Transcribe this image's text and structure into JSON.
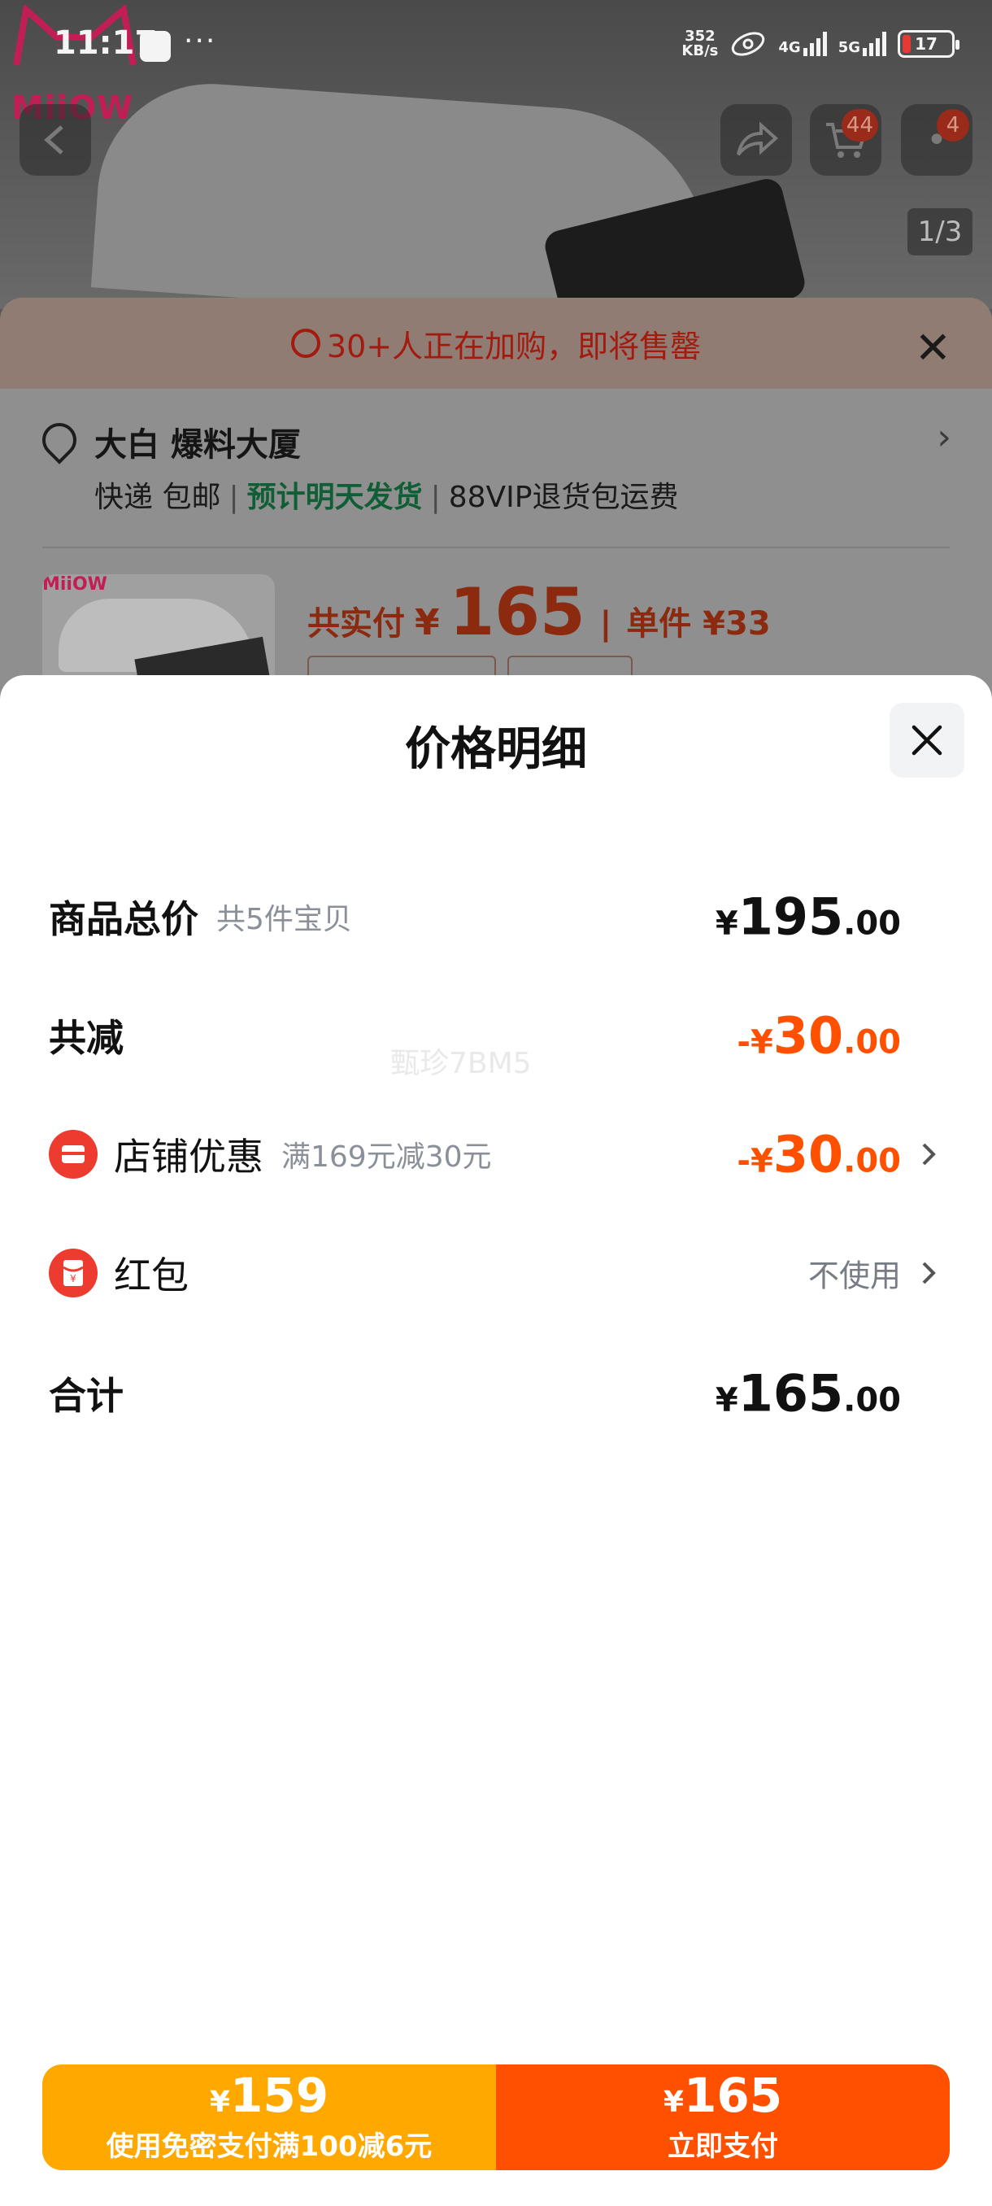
{
  "status_bar": {
    "time": "11:17",
    "dots": "···",
    "net_speed_value": "352",
    "net_speed_unit": "KB/s",
    "sig1": "4G",
    "sig2": "5G",
    "battery": "17"
  },
  "background": {
    "logo_text": "MiiOW",
    "cart_badge": "44",
    "more_badge": "4",
    "pager": "1/3",
    "urgency_text": "30+人正在加购，即将售罄",
    "address_name": "大白 爆料大厦",
    "ship_1": "快递 包邮",
    "ship_2": "预计明天发货",
    "ship_3": "88VIP退货包运费",
    "pay_label": "共实付",
    "pay_currency": "¥",
    "pay_amount": "165",
    "unit_label": "单件 ¥33"
  },
  "sheet": {
    "title": "价格明细",
    "watermark": "甄珍7BM5",
    "rows": {
      "total": {
        "label": "商品总价",
        "sub": "共5件宝贝",
        "currency": "¥",
        "int": "195",
        "dec": ".00"
      },
      "reduce": {
        "label": "共减",
        "currency": "-¥",
        "int": "30",
        "dec": ".00"
      },
      "store": {
        "label": "店铺优惠",
        "sub": "满169元减30元",
        "currency": "-¥",
        "int": "30",
        "dec": ".00"
      },
      "hongbao": {
        "label": "红包",
        "action": "不使用"
      },
      "sum": {
        "label": "合计",
        "currency": "¥",
        "int": "165",
        "dec": ".00"
      }
    }
  },
  "paybar": {
    "left_currency": "¥",
    "left_amount": "159",
    "left_label": "使用免密支付满100减6元",
    "right_currency": "¥",
    "right_amount": "165",
    "right_label": "立即支付"
  },
  "colors": {
    "accent_orange": "#ff5000",
    "secondary_orange": "#ffa800",
    "hongbao_red": "#ee3b2f"
  }
}
